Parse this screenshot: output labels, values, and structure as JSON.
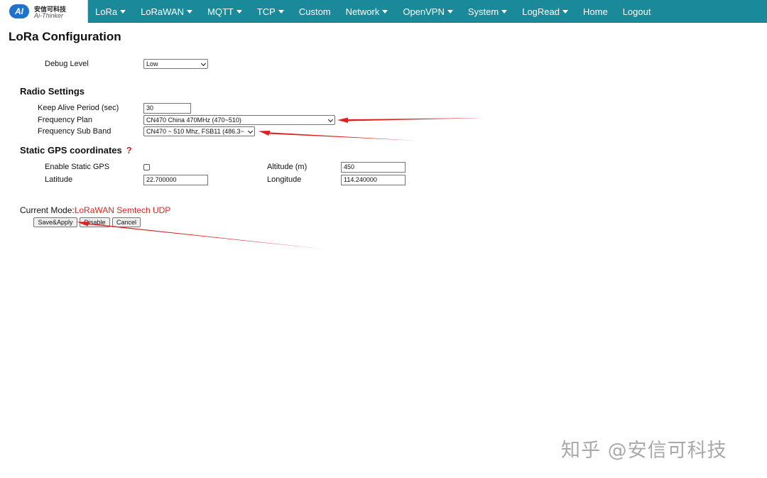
{
  "brand": {
    "logo_text": "AI",
    "cn_name": "安信可科技",
    "en_name": "Ai-Thinker"
  },
  "nav": [
    {
      "label": "LoRa",
      "dropdown": true
    },
    {
      "label": "LoRaWAN",
      "dropdown": true
    },
    {
      "label": "MQTT",
      "dropdown": true
    },
    {
      "label": "TCP",
      "dropdown": true
    },
    {
      "label": "Custom",
      "dropdown": false
    },
    {
      "label": "Network",
      "dropdown": true
    },
    {
      "label": "OpenVPN",
      "dropdown": true
    },
    {
      "label": "System",
      "dropdown": true
    },
    {
      "label": "LogRead",
      "dropdown": true
    },
    {
      "label": "Home",
      "dropdown": false
    },
    {
      "label": "Logout",
      "dropdown": false
    }
  ],
  "page": {
    "title": "LoRa Configuration"
  },
  "debug": {
    "label": "Debug Level",
    "value": "Low"
  },
  "radio": {
    "heading": "Radio Settings",
    "keep_alive_label": "Keep Alive Period (sec)",
    "keep_alive_value": "30",
    "freq_plan_label": "Frequency Plan",
    "freq_plan_value": "CN470 China 470MHz (470~510)",
    "sub_band_label": "Frequency Sub Band",
    "sub_band_value": "CN470 ~ 510 Mhz, FSB11 (486.3~"
  },
  "gps": {
    "heading": "Static GPS coordinates",
    "help": "?",
    "enable_label": "Enable Static GPS",
    "enable_checked": false,
    "altitude_label": "Altitude (m)",
    "altitude_value": "450",
    "latitude_label": "Latitude",
    "latitude_value": "22.700000",
    "longitude_label": "Longitude",
    "longitude_value": "114.240000"
  },
  "mode": {
    "label": "Current Mode:",
    "value": "LoRaWAN Semtech UDP"
  },
  "buttons": {
    "save": "Save&Apply",
    "disable": "Disable",
    "cancel": "Cancel"
  },
  "annotation": {
    "arrow_color": "#e02020"
  },
  "watermark": "知乎 @安信可科技",
  "colors": {
    "navbar": "#1a8a9a",
    "mode_value": "#e02222"
  }
}
